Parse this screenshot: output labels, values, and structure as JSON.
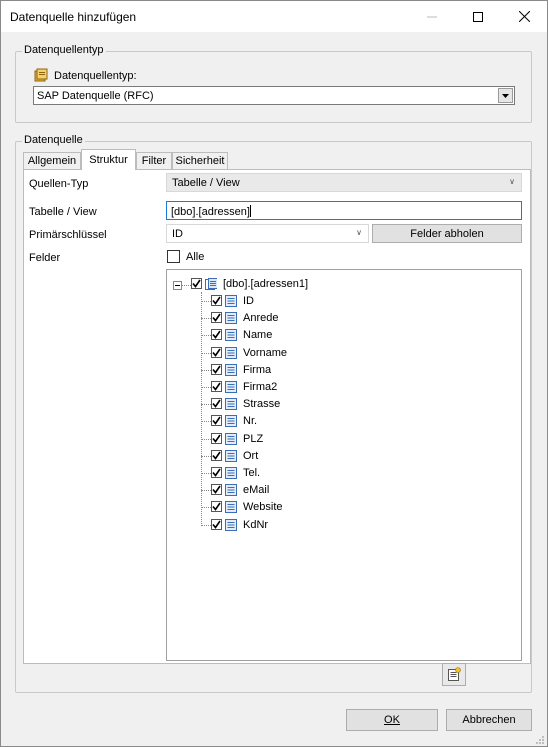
{
  "window": {
    "title": "Datenquelle hinzufügen"
  },
  "group_type": {
    "legend": "Datenquellentyp",
    "field_label": "Datenquellentyp:",
    "selected": "SAP Datenquelle (RFC)"
  },
  "group_source": {
    "legend": "Datenquelle"
  },
  "tabs": [
    {
      "label": "Allgemein"
    },
    {
      "label": "Struktur"
    },
    {
      "label": "Filter"
    },
    {
      "label": "Sicherheit"
    }
  ],
  "struktur": {
    "quellen_typ_label": "Quellen-Typ",
    "quellen_typ_value": "Tabelle / View",
    "tabelle_label": "Tabelle / View",
    "tabelle_value": "[dbo].[adressen]",
    "primaer_label": "Primärschlüssel",
    "primaer_value": "ID",
    "felder_abholen": "Felder abholen",
    "felder_label": "Felder",
    "alle_label": "Alle"
  },
  "tree": {
    "root": "[dbo].[adressen1]",
    "fields": [
      "ID",
      "Anrede",
      "Name",
      "Vorname",
      "Firma",
      "Firma2",
      "Strasse",
      "Nr.",
      "PLZ",
      "Ort",
      "Tel.",
      "eMail",
      "Website",
      "KdNr"
    ]
  },
  "buttons": {
    "ok": "OK",
    "cancel": "Abbrechen"
  },
  "icons": [
    "minimize-icon",
    "maximize-icon",
    "close-icon",
    "datasource-icon",
    "table-icon",
    "field-icon",
    "add-field-icon"
  ]
}
